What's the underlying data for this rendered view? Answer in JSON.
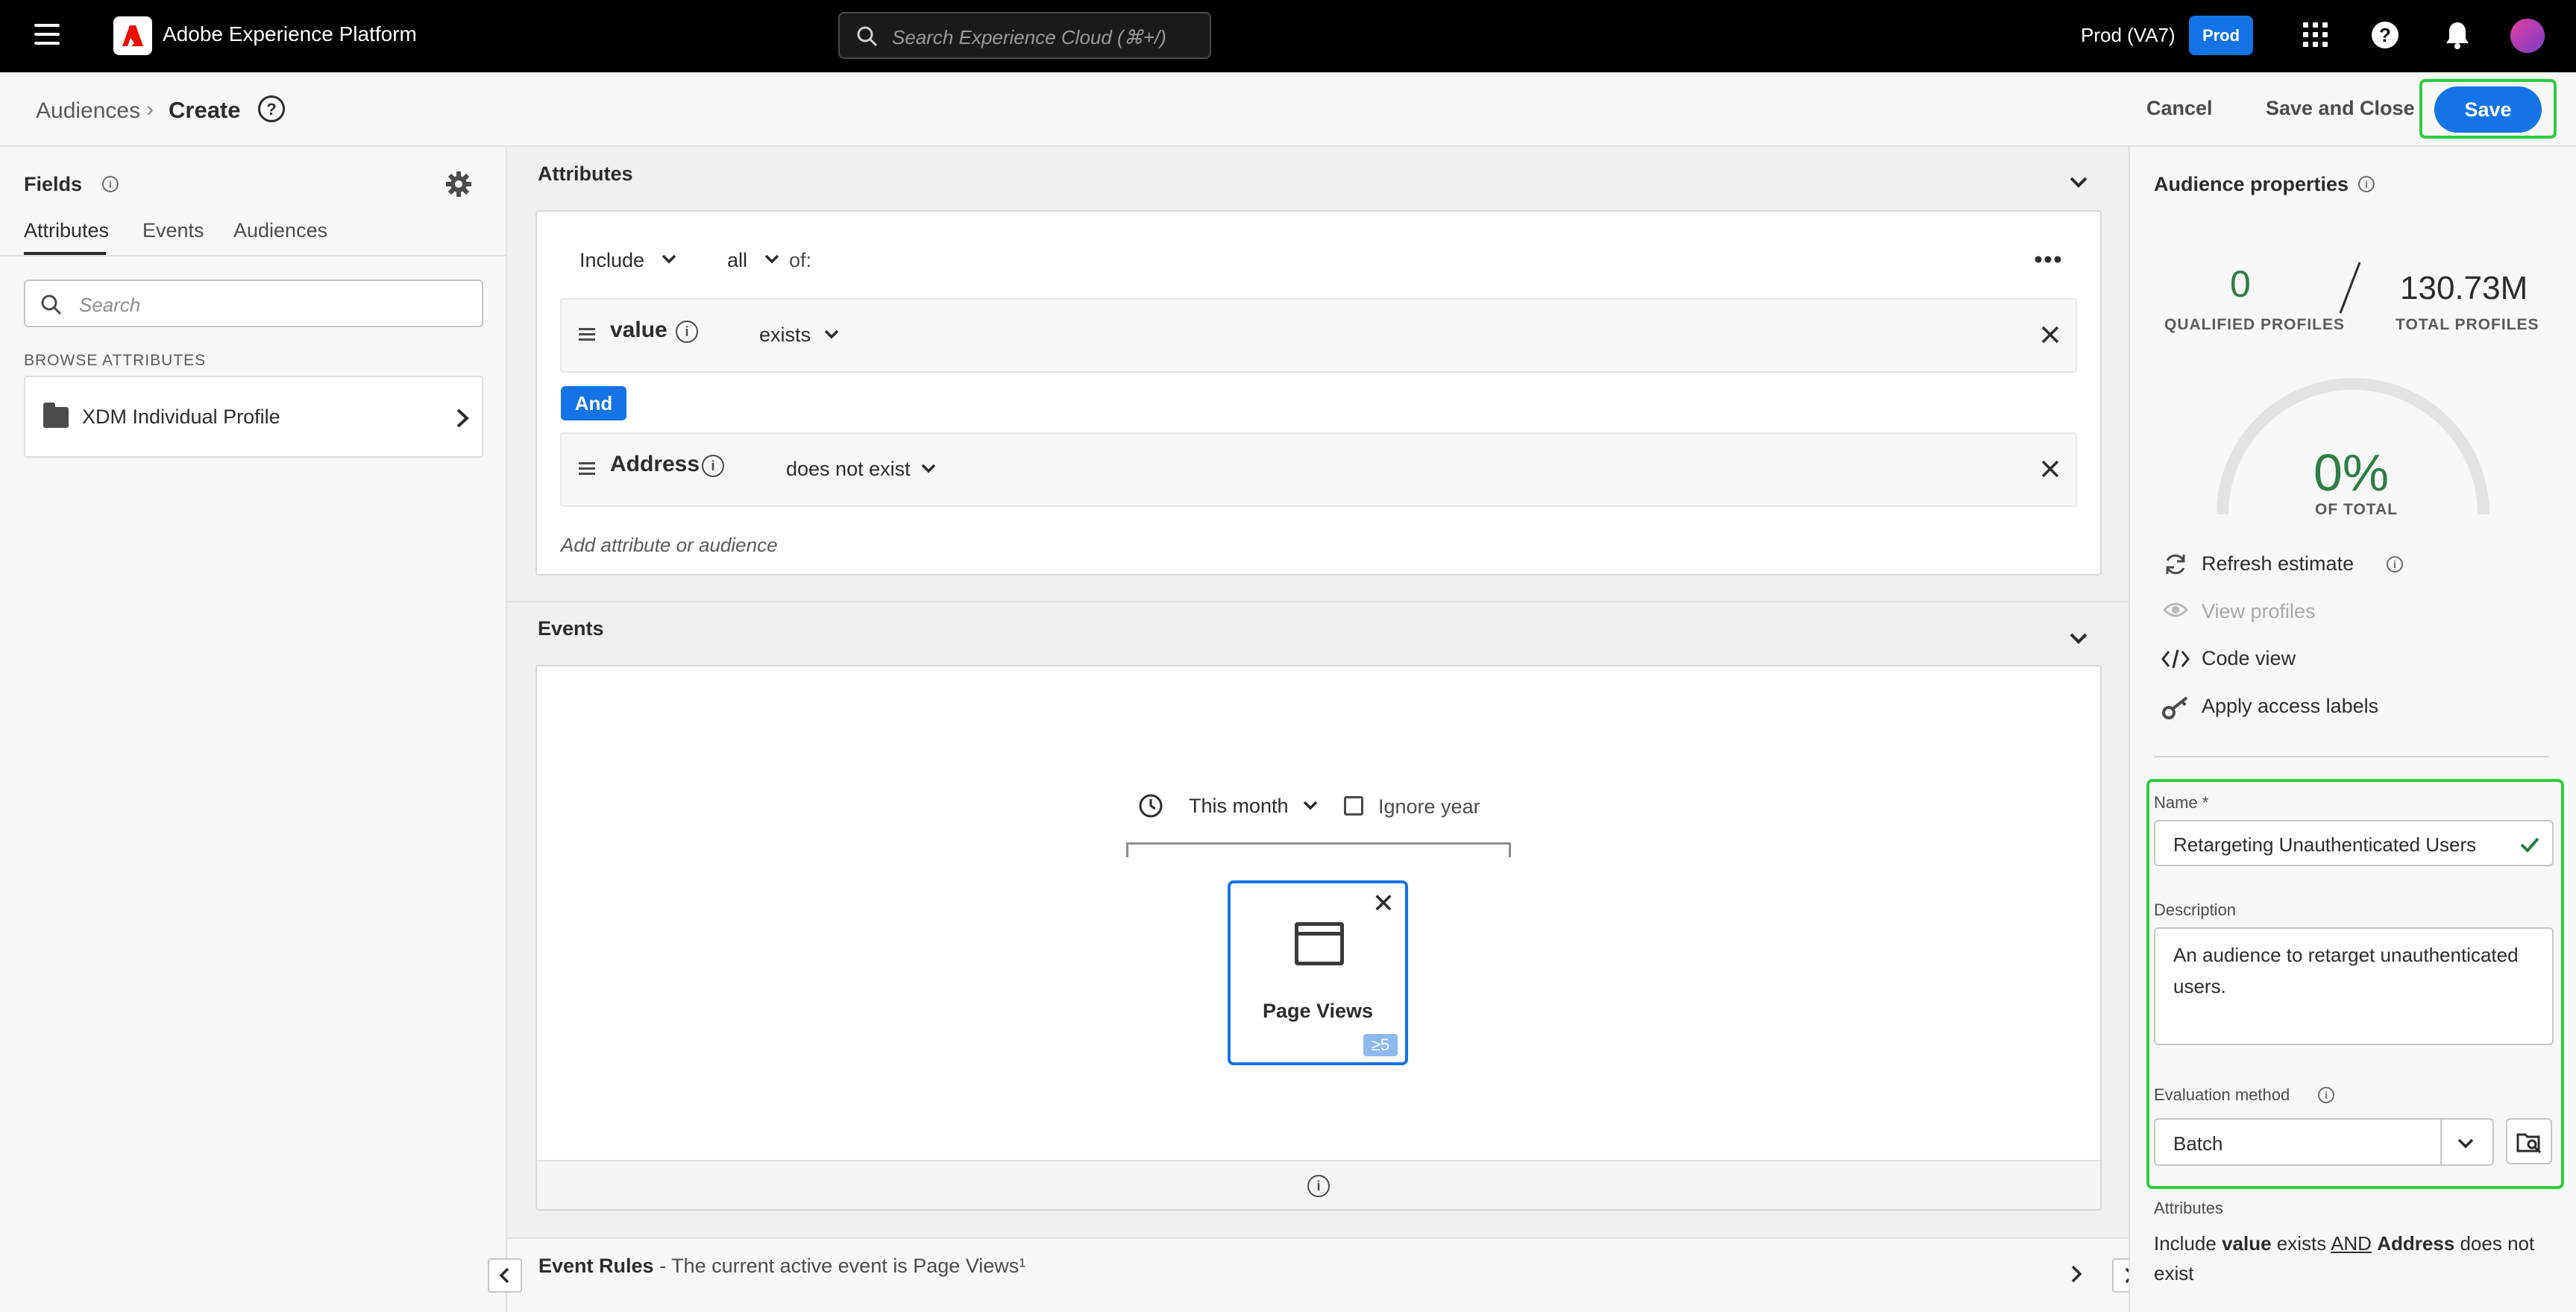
{
  "topbar": {
    "app_title": "Adobe Experience Platform",
    "search_placeholder": "Search Experience Cloud (⌘+/)",
    "environment": "Prod (VA7)",
    "env_badge": "Prod",
    "help_glyph": "?"
  },
  "header": {
    "breadcrumb_parent": "Audiences",
    "breadcrumb_separator": "›",
    "breadcrumb_current": "Create",
    "help_glyph": "?",
    "cancel_label": "Cancel",
    "save_close_label": "Save and Close",
    "save_label": "Save"
  },
  "left": {
    "title": "Fields",
    "tabs": [
      "Attributes",
      "Events",
      "Audiences"
    ],
    "active_tab": "Attributes",
    "search_placeholder": "Search",
    "browse_label": "BROWSE ATTRIBUTES",
    "xdm_item": "XDM Individual Profile"
  },
  "attributes": {
    "section_title": "Attributes",
    "include_label": "Include",
    "all_label": "all",
    "of_label": "of:",
    "rules": [
      {
        "name": "value",
        "operator": "exists"
      },
      {
        "name": "Address",
        "operator": "does not exist"
      }
    ],
    "and_label": "And",
    "add_label": "Add attribute or audience"
  },
  "events": {
    "section_title": "Events",
    "time_label": "This month",
    "ignore_year_label": "Ignore year",
    "event_card_label": "Page Views",
    "event_badge": "≥5",
    "rules_title": "Event Rules",
    "rules_text": " - The current active event is Page Views¹"
  },
  "properties": {
    "title": "Audience properties",
    "qualified": "0",
    "qualified_label": "QUALIFIED PROFILES",
    "total": "130.73M",
    "total_label": "TOTAL PROFILES",
    "percent": "0%",
    "percent_label": "OF TOTAL",
    "percent_value": 0,
    "actions": {
      "refresh": "Refresh estimate",
      "view": "View profiles",
      "code": "Code view",
      "access": "Apply access labels"
    },
    "name_label": "Name *",
    "name_value": "Retargeting Unauthenticated Users",
    "description_label": "Description",
    "description_value": "An audience to retarget unauthenticated users.",
    "evaluation_label": "Evaluation method",
    "evaluation_value": "Batch",
    "attributes_label": "Attributes",
    "summary_include": "Include ",
    "summary_value": "value",
    "summary_exists": " exists ",
    "summary_and": "AND",
    "summary_address": "Address",
    "summary_tail": " does not exist"
  },
  "colors": {
    "accent": "#1473e6",
    "highlight": "#2ecc40",
    "positive": "#2d7d46"
  }
}
